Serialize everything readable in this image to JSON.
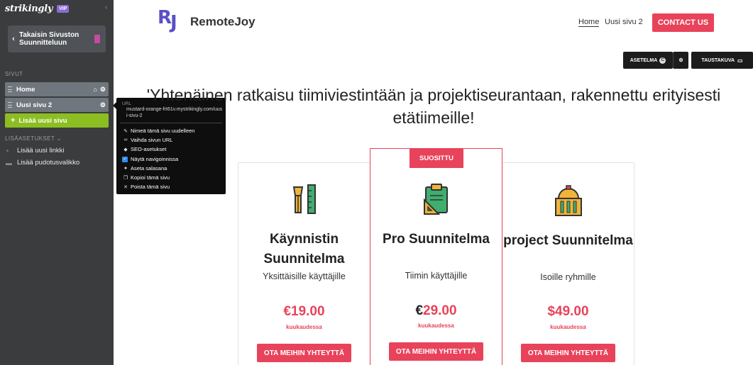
{
  "sidebar": {
    "logo": "strikingly",
    "vip": "VIP",
    "collapse_icon": "chevron-left-icon",
    "back_label": "Takaisin Sivuston Suunnitteluun",
    "pages_section": "SIVUT",
    "pages": [
      {
        "name": "Home",
        "icons": [
          "home-icon",
          "gear-icon"
        ]
      },
      {
        "name": "Uusi sivu 2",
        "icons": [
          "gear-icon"
        ]
      }
    ],
    "add_page": "Lisää uusi sivu",
    "extra_section": "LISÄASETUKSET ⌄",
    "links": [
      {
        "label": "Lisää uusi linkki",
        "icon": "plus-icon"
      },
      {
        "label": "Lisää pudotusvalikko",
        "icon": "folder-icon"
      }
    ]
  },
  "context_menu": {
    "url_label": "URL",
    "url_value": "mustard-orange-frt61v.mystrikingly.com/uusi-sivu-2",
    "items": [
      "Nimeä tämä sivu uudelleen",
      "Vaihda sivun URL",
      "SEO-asetukset",
      "Näytä navigoinnissa",
      "Aseta salasana",
      "Kopioi tämä sivu",
      "Poista tämä sivu"
    ]
  },
  "site": {
    "logo_mark": [
      "R",
      "J"
    ],
    "name": "RemoteJoy",
    "nav": [
      "Home",
      "Uusi sivu 2"
    ],
    "contact": "CONTACT US",
    "editor_buttons": {
      "settings": "ASETELMA",
      "settings_badge": "C",
      "background": "TAUSTAKUVA"
    },
    "hero": "'Yhtenäinen ratkaisu tiimiviestintään ja projektiseurantaan, rakennettu erityisesti etätiimeille!"
  },
  "plans": [
    {
      "title": "Käynnistin Suunnitelma",
      "subtitle": "Yksittäisille käyttäjille",
      "price": "€19.00",
      "period": "kuukaudessa",
      "cta": "OTA MEIHIN YHTEYTTÄ",
      "icon": "pen-ruler-icon"
    },
    {
      "badge": "SUOSITTU",
      "title": "Pro Suunnitelma",
      "subtitle": "Tiimin käyttäjille",
      "price_currency": "€",
      "price_amount": "29.00",
      "period": "kuukaudessa",
      "cta": "OTA MEIHIN YHTEYTTÄ",
      "icon": "clipboard-icon"
    },
    {
      "title": "project Suunnitelma",
      "subtitle": "Isoille ryhmille",
      "price": "$49.00",
      "period": "kuukaudessa",
      "cta": "OTA MEIHIN YHTEYTTÄ",
      "icon": "building-icon"
    }
  ],
  "colors": {
    "accent": "#e8435a",
    "brand": "#5b4fc7",
    "add_page": "#8cbe22",
    "sidebar": "#3b3c3e"
  }
}
